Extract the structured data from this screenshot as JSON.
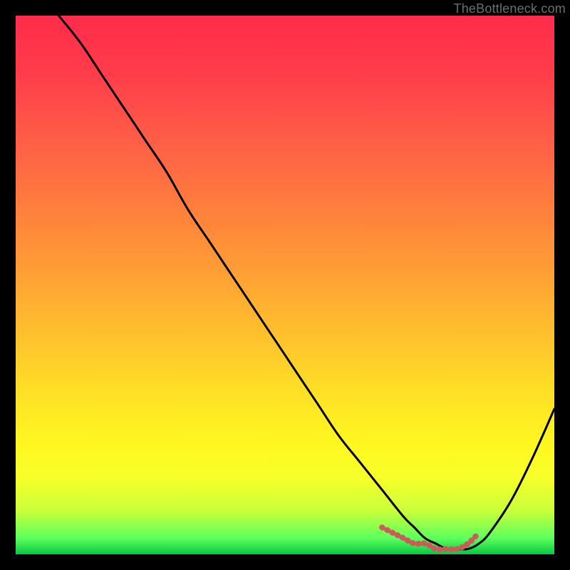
{
  "watermark": "TheBottleneck.com",
  "chart_data": {
    "type": "line",
    "title": "",
    "xlabel": "",
    "ylabel": "",
    "xlim": [
      0,
      100
    ],
    "ylim": [
      0,
      100
    ],
    "gradient_stops": [
      {
        "pos": 0.0,
        "color": "#ff2b4a"
      },
      {
        "pos": 0.1,
        "color": "#ff3b4a"
      },
      {
        "pos": 0.22,
        "color": "#ff5a48"
      },
      {
        "pos": 0.34,
        "color": "#ff7a3e"
      },
      {
        "pos": 0.46,
        "color": "#ff9a36"
      },
      {
        "pos": 0.58,
        "color": "#ffbd2e"
      },
      {
        "pos": 0.7,
        "color": "#ffe026"
      },
      {
        "pos": 0.8,
        "color": "#fff820"
      },
      {
        "pos": 0.86,
        "color": "#f7ff2a"
      },
      {
        "pos": 0.92,
        "color": "#c8ff3a"
      },
      {
        "pos": 0.97,
        "color": "#5dff5d"
      },
      {
        "pos": 1.0,
        "color": "#07c842"
      }
    ],
    "series": [
      {
        "name": "bottleneck-curve",
        "color": "#000000",
        "x": [
          8,
          12,
          16,
          20,
          24,
          28,
          32,
          36,
          40,
          44,
          48,
          52,
          56,
          60,
          64,
          68,
          72,
          74,
          76,
          78,
          80,
          82,
          84,
          86,
          88,
          92,
          96,
          100
        ],
        "y": [
          100,
          95,
          89,
          83,
          77,
          71,
          64,
          58,
          52,
          46,
          40,
          34,
          28,
          22,
          17,
          12,
          7,
          5,
          3,
          2,
          1,
          1,
          1,
          2,
          4,
          10,
          18,
          27
        ]
      },
      {
        "name": "optimal-region",
        "color": "#d05a5a",
        "x": [
          68,
          70,
          72,
          74,
          76,
          78,
          80,
          82,
          84,
          86
        ],
        "y": [
          5,
          4,
          3,
          2,
          2,
          1,
          1,
          1,
          2,
          4
        ]
      }
    ]
  }
}
